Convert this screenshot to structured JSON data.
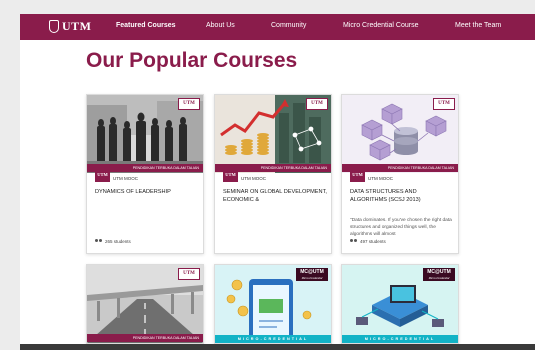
{
  "brand": {
    "name": "UTM"
  },
  "nav": {
    "items": [
      {
        "label": "Featured Courses"
      },
      {
        "label": "About Us"
      },
      {
        "label": "Community"
      },
      {
        "label": "Micro Credential Course"
      },
      {
        "label": "Meet the Team"
      }
    ]
  },
  "page": {
    "title": "Our Popular Courses"
  },
  "courses": [
    {
      "badge": "UTM",
      "ribbon": "PENDIDIKAN TERBUKA DALAM TALIAN",
      "tag_logo": "UTM",
      "tag": "UTM MOOC",
      "title": "DYNAMICS OF LEADERSHIP",
      "desc": "",
      "students": "265 students"
    },
    {
      "badge": "UTM",
      "ribbon": "PENDIDIKAN TERBUKA DALAM TALIAN",
      "tag_logo": "UTM",
      "tag": "UTM MOOC",
      "title": "SEMINAR ON GLOBAL DEVELOPMENT, ECONOMIC &",
      "desc": "",
      "students": ""
    },
    {
      "badge": "UTM",
      "ribbon": "PENDIDIKAN TERBUKA DALAM TALIAN",
      "tag_logo": "UTM",
      "tag": "UTM MOOC",
      "title": "DATA STRUCTURES AND ALGORITHMS (SCSJ 2013)",
      "desc": "\"Data dominates. If you've chosen the right data structures and organized things well, the algorithms will almost",
      "students": "497 students"
    },
    {
      "badge": "UTM",
      "ribbon": "PENDIDIKAN TERBUKA DALAM TALIAN"
    },
    {
      "badge": "MC@UTM",
      "badge_sub": "Micro-Credential",
      "strip": "MICRO-CREDENTIAL"
    },
    {
      "badge": "MC@UTM",
      "badge_sub": "Micro-Credential",
      "strip": "MICRO-CREDENTIAL"
    }
  ],
  "colors": {
    "brand": "#8a1c4b",
    "accent": "#12b3c6",
    "background": "#ececec"
  },
  "icons": [
    "utm-crest-icon",
    "users-icon"
  ]
}
